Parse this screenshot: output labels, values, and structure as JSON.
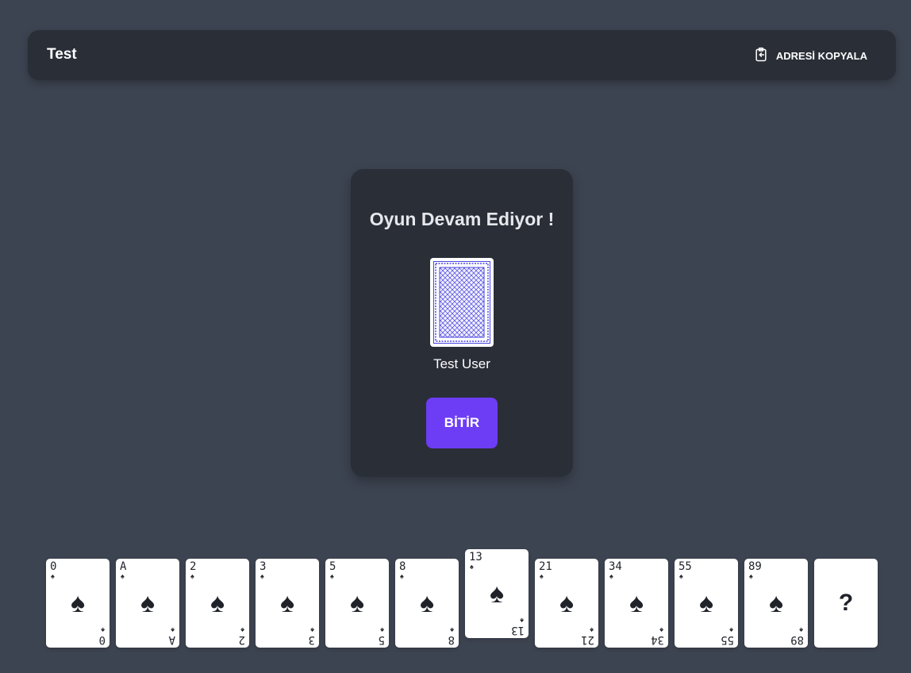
{
  "header": {
    "title": "Test",
    "copy_button_label": "ADRESİ KOPYALA",
    "copy_icon": "clipboard-copy-icon"
  },
  "panel": {
    "status_text": "Oyun Devam Ediyor !",
    "player_name": "Test User",
    "finish_button_label": "BİTİR",
    "card_back_color": "#4a46e0"
  },
  "hand": {
    "suit_symbol": "♠",
    "selected_value": "13",
    "cards": [
      {
        "value": "0",
        "selected": false
      },
      {
        "value": "A",
        "selected": false
      },
      {
        "value": "2",
        "selected": false
      },
      {
        "value": "3",
        "selected": false
      },
      {
        "value": "5",
        "selected": false
      },
      {
        "value": "8",
        "selected": false
      },
      {
        "value": "13",
        "selected": true
      },
      {
        "value": "21",
        "selected": false
      },
      {
        "value": "34",
        "selected": false
      },
      {
        "value": "55",
        "selected": false
      },
      {
        "value": "89",
        "selected": false
      },
      {
        "value": "?",
        "selected": false,
        "special": true
      }
    ]
  },
  "colors": {
    "background": "#3d4451",
    "surface": "#2a2e37",
    "accent": "#6d3df5"
  }
}
